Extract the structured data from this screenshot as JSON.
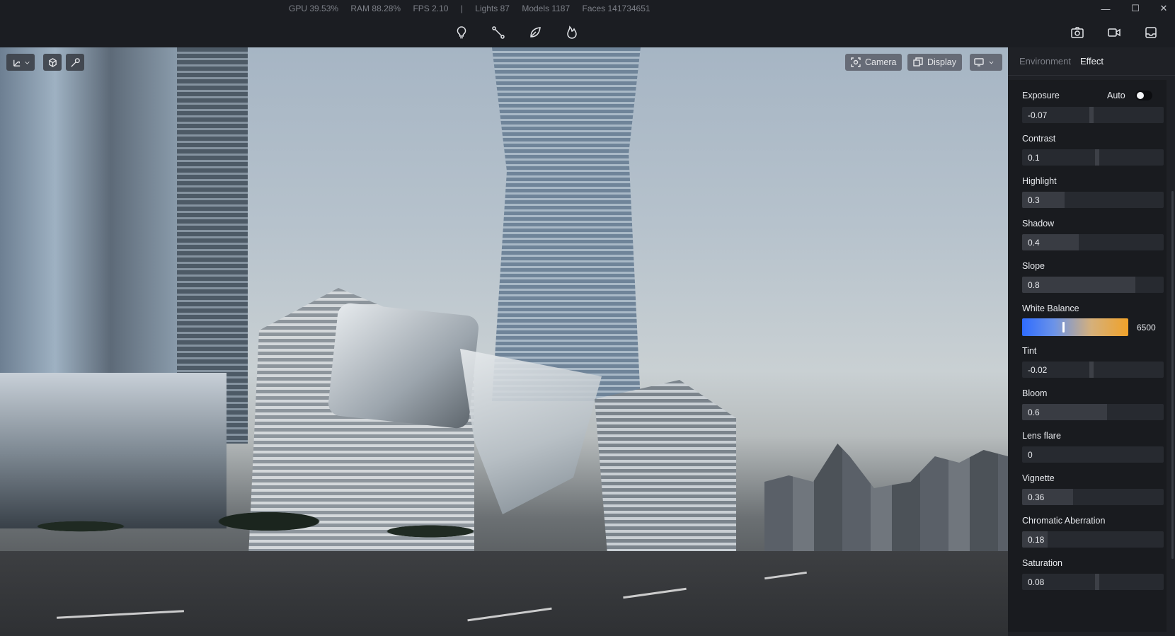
{
  "status": {
    "gpu": "GPU 39.53%",
    "ram": "RAM 88.28%",
    "fps": "FPS 2.10",
    "separator": "|",
    "lights": "Lights 87",
    "models": "Models 1187",
    "faces": "Faces 141734651"
  },
  "window_controls": {
    "minimize": "—",
    "maximize": "☐",
    "close": "✕"
  },
  "toolbar": {
    "tools": [
      "lightbulb-icon",
      "path-icon",
      "leaf-icon",
      "flame-icon"
    ],
    "right": [
      "camera-icon",
      "video-icon",
      "render-output-icon"
    ]
  },
  "viewport": {
    "camera_label": "Camera",
    "display_label": "Display"
  },
  "panel": {
    "tabs": [
      {
        "label": "Environment",
        "active": false
      },
      {
        "label": "Effect",
        "active": true
      }
    ],
    "auto_label": "Auto",
    "auto_on": false,
    "params": [
      {
        "label": "Exposure",
        "value": "-0.07",
        "position": 0.49
      },
      {
        "label": "Contrast",
        "value": "0.1",
        "position": 0.53
      },
      {
        "label": "Highlight",
        "value": "0.3",
        "position": 0.3
      },
      {
        "label": "Shadow",
        "value": "0.4",
        "position": 0.4
      },
      {
        "label": "Slope",
        "value": "0.8",
        "position": 0.8
      },
      {
        "label": "White Balance",
        "value": "6500",
        "position": 0.38
      },
      {
        "label": "Tint",
        "value": "-0.02",
        "position": 0.49
      },
      {
        "label": "Bloom",
        "value": "0.6",
        "position": 0.6
      },
      {
        "label": "Lens flare",
        "value": "0",
        "position": 0
      },
      {
        "label": "Vignette",
        "value": "0.36",
        "position": 0.36
      },
      {
        "label": "Chromatic Aberration",
        "value": "0.18",
        "position": 0.18
      },
      {
        "label": "Saturation",
        "value": "0.08",
        "position": 0.53
      }
    ]
  }
}
